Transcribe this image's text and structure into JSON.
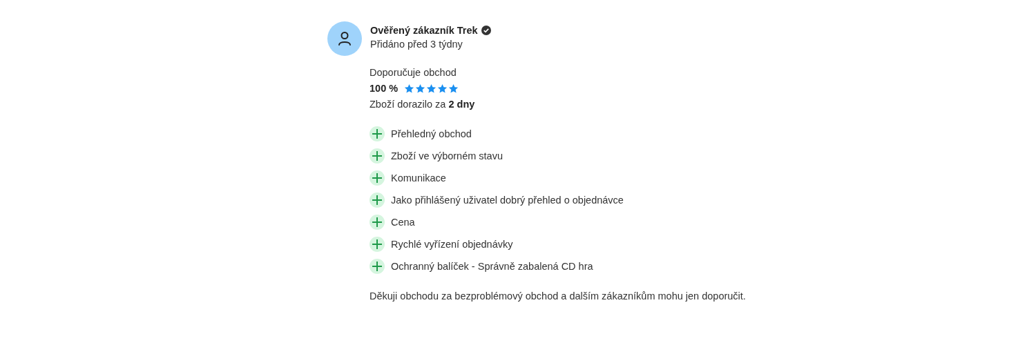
{
  "review": {
    "author": "Ověřený zákazník Trek",
    "verified": true,
    "added": "Přidáno před 3 týdny",
    "recommends_label": "Doporučuje obchod",
    "percent": "100 %",
    "stars": 5,
    "delivery": "Zboží dorazilo za **2 dny**",
    "pros": [
      "Přehledný obchod",
      "Zboží ve výborném stavu",
      "Komunikace",
      "Jako přihlášený uživatel dobrý přehled o objednávce",
      "Cena",
      "Rychlé vyřízení objednávky",
      "Ochranný balíček - Správně zabalená CD hra"
    ],
    "comment": "Děkuji obchodu za bezproblémový obchod a dalším zákazníkům mohu jen doporučit."
  }
}
